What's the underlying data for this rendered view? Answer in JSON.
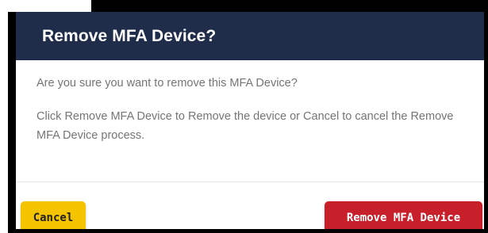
{
  "dialog": {
    "title": "Remove MFA Device?",
    "confirm_question": "Are you sure you want to remove this MFA Device?",
    "instructions": "Click Remove MFA Device to Remove the device or Cancel to cancel the Remove MFA Device process.",
    "cancel_label": "Cancel",
    "remove_label": "Remove MFA Device"
  },
  "colors": {
    "header_bg": "#1f2d4a",
    "cancel_button": "#f5c400",
    "remove_button": "#c8202b",
    "body_text": "#757575"
  }
}
